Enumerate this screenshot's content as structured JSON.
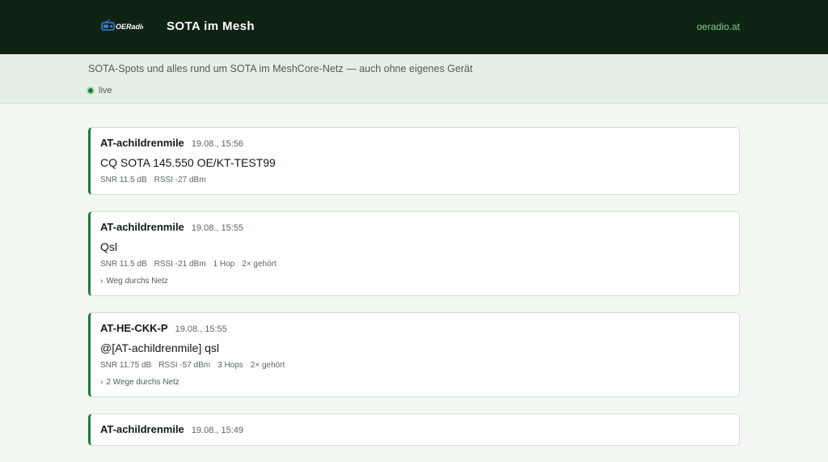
{
  "header": {
    "logo_text": "OERadio",
    "title": "SOTA im Mesh",
    "link": "oeradio.at"
  },
  "subheader": {
    "tagline": "SOTA-Spots und alles rund um SOTA im MeshCore-Netz — auch ohne eigenes Gerät",
    "status": "live"
  },
  "colors": {
    "topbar": "#0f2313",
    "accent": "#1f7a3a",
    "link": "#7fd08e"
  },
  "messages": [
    {
      "sender": "AT-achildrenmile",
      "time": "19.08., 15:56",
      "text": "CQ SOTA 145.550 OE/KT-TEST99",
      "meta": [
        "SNR 11.5 dB",
        "RSSI -27 dBm"
      ]
    },
    {
      "sender": "AT-achildrenmile",
      "time": "19.08., 15:55",
      "text": "Qsl",
      "meta": [
        "SNR 11.5 dB",
        "RSSI -21 dBm",
        "1 Hop",
        "2× gehört"
      ],
      "path_label": "Weg durchs Netz"
    },
    {
      "sender": "AT-HE-CKK-P",
      "time": "19.08., 15:55",
      "text": "@[AT-achildrenmile] qsl",
      "meta": [
        "SNR 11.75 dB",
        "RSSI -57 dBm",
        "3 Hops",
        "2× gehört"
      ],
      "path_label": "2 Wege durchs Netz"
    },
    {
      "sender": "AT-achildrenmile",
      "time": "19.08., 15:49",
      "text": "",
      "meta": []
    }
  ]
}
